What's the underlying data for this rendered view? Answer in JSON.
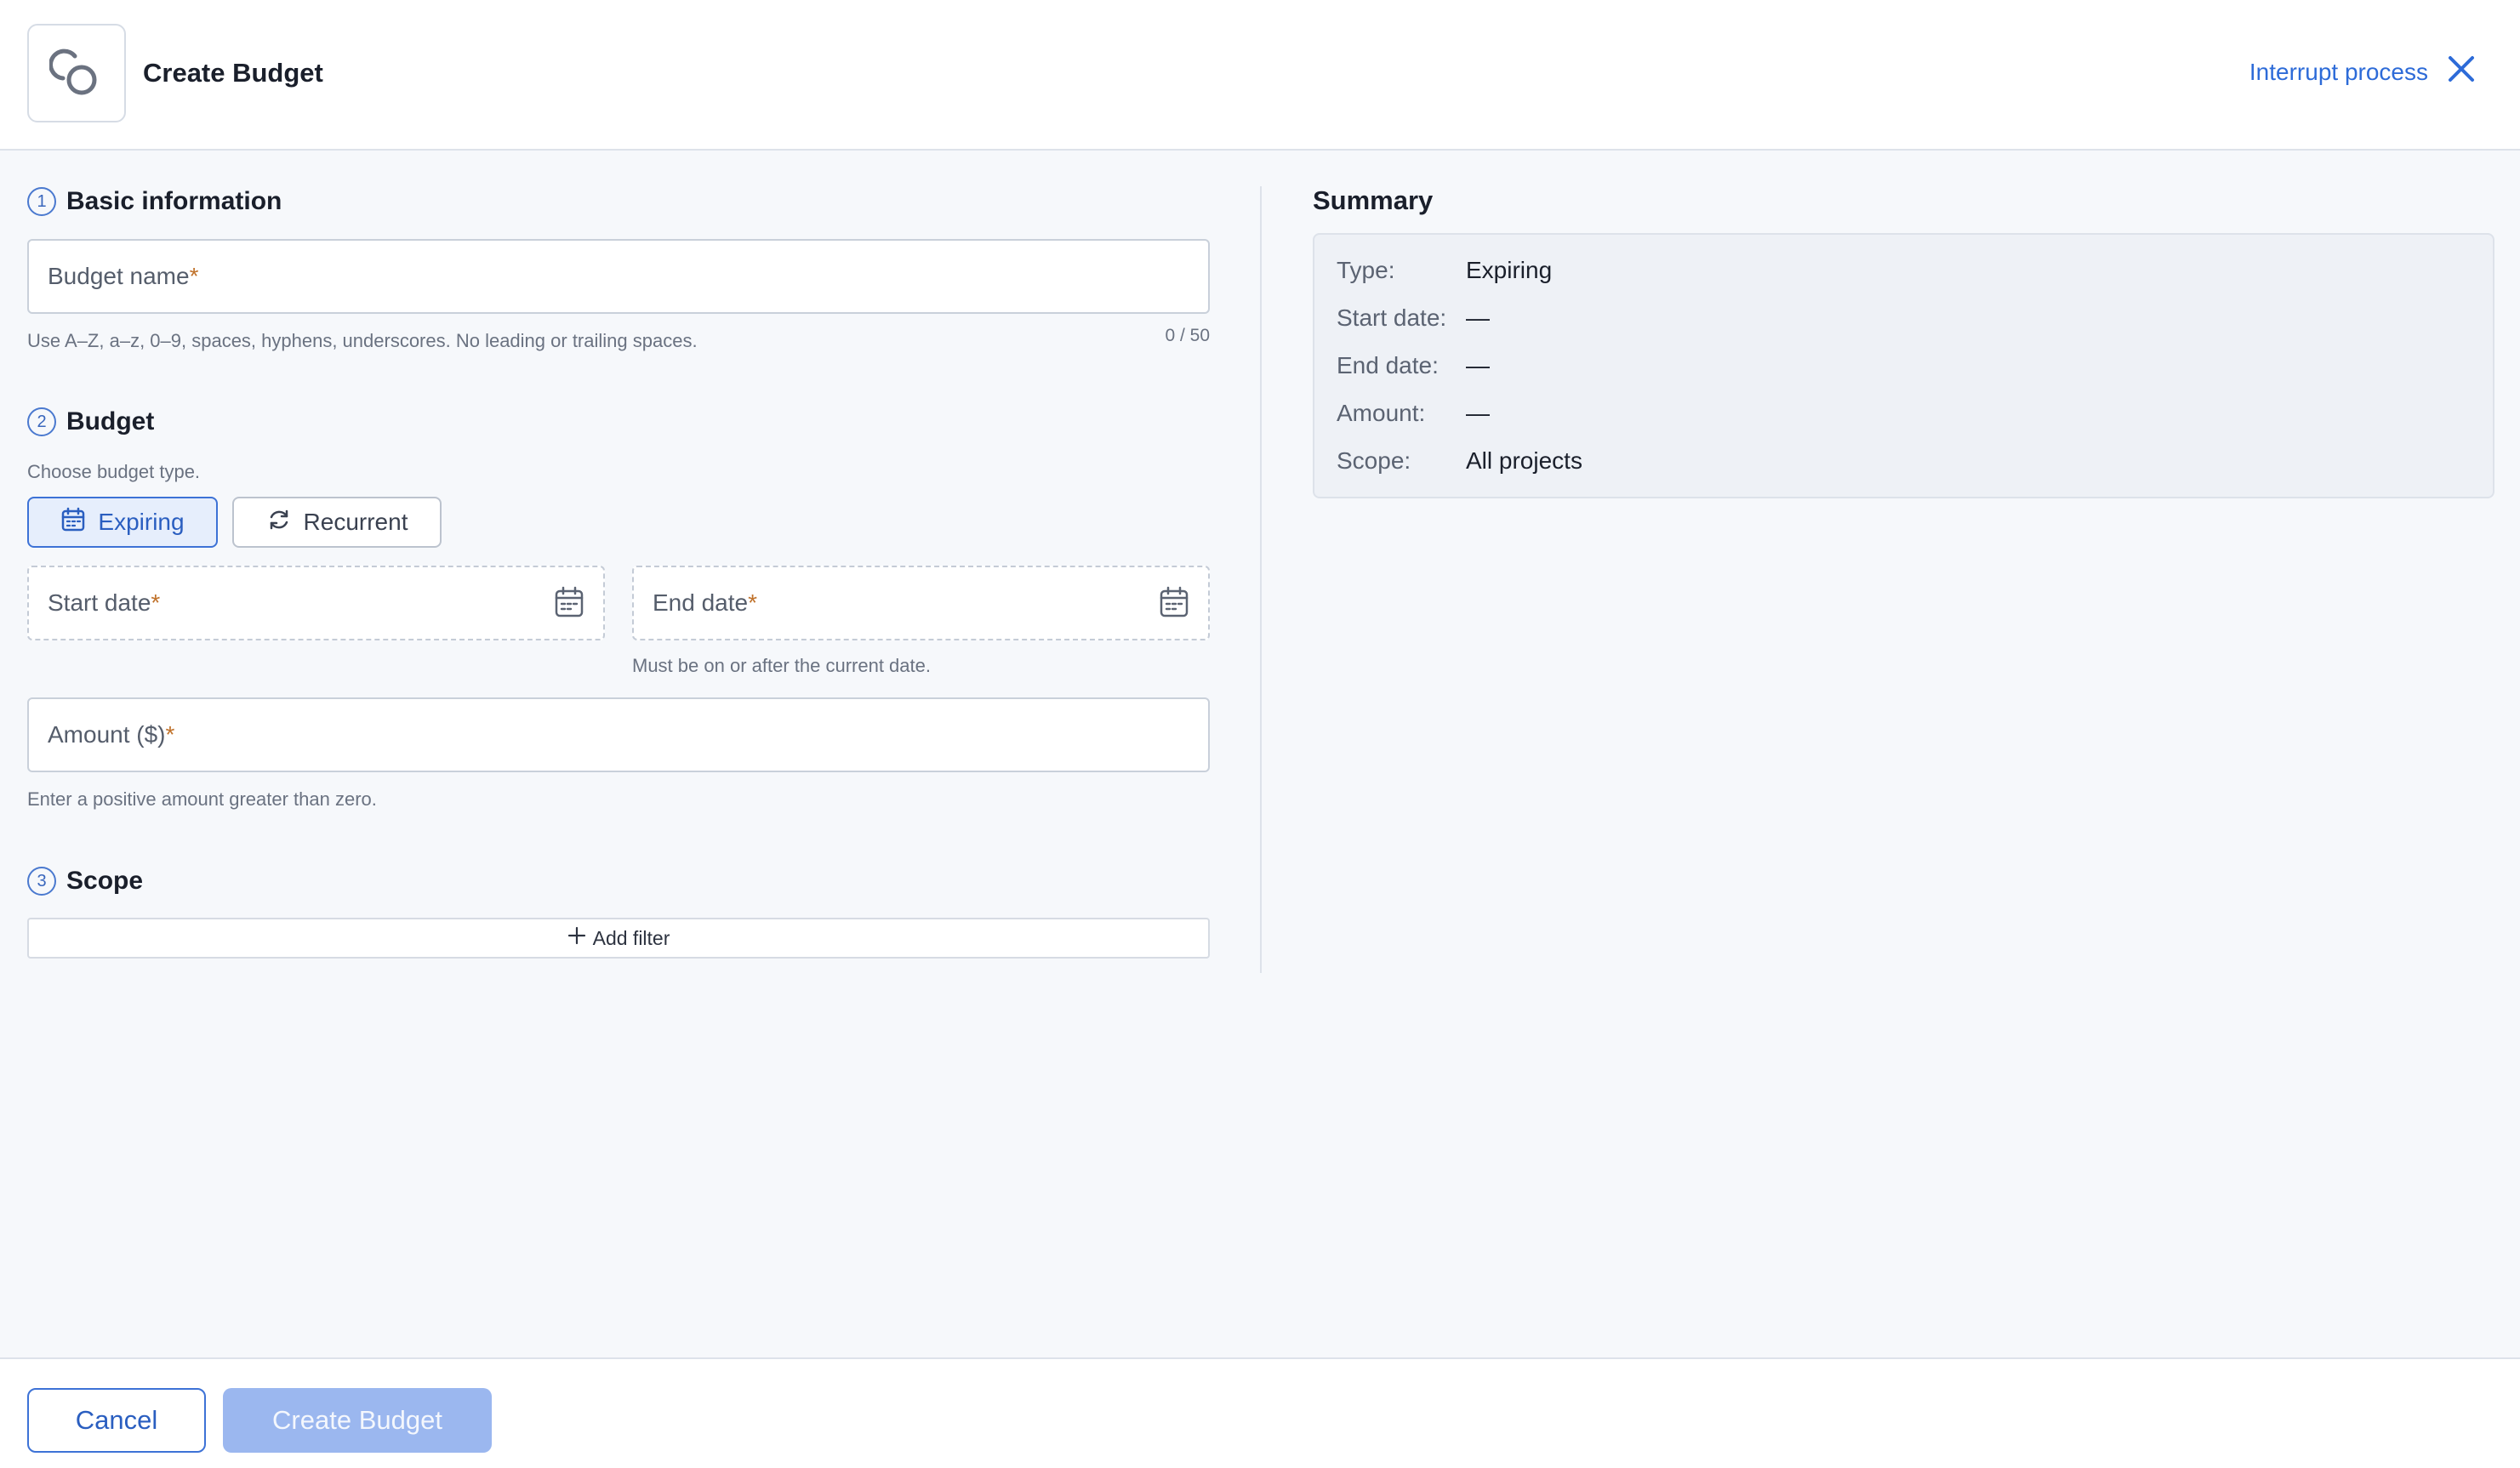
{
  "header": {
    "title": "Create Budget",
    "interrupt_label": "Interrupt process"
  },
  "basic": {
    "step": "1",
    "title": "Basic information",
    "name_label": "Budget name",
    "name_hint": "Use A–Z, a–z, 0–9, spaces, hyphens, underscores. No leading or trailing spaces.",
    "name_counter": "0 / 50"
  },
  "budget": {
    "step": "2",
    "title": "Budget",
    "type_prompt": "Choose budget type.",
    "type_options": [
      {
        "label": "Expiring",
        "icon": "calendar-icon",
        "selected": true
      },
      {
        "label": "Recurrent",
        "icon": "refresh-icon",
        "selected": false
      }
    ],
    "start_label": "Start date",
    "end_label": "End date",
    "end_hint": "Must be on or after the current date.",
    "amount_label": "Amount ($)",
    "amount_hint": "Enter a positive amount greater than zero."
  },
  "scope": {
    "step": "3",
    "title": "Scope",
    "add_filter_label": "Add filter"
  },
  "summary": {
    "title": "Summary",
    "rows": [
      {
        "label": "Type:",
        "value": "Expiring"
      },
      {
        "label": "Start date:",
        "value": "—"
      },
      {
        "label": "End date:",
        "value": "—"
      },
      {
        "label": "Amount:",
        "value": "—"
      },
      {
        "label": "Scope:",
        "value": "All projects"
      }
    ]
  },
  "footer": {
    "cancel_label": "Cancel",
    "create_label": "Create Budget"
  },
  "colors": {
    "accent": "#2d6bd8",
    "required": "#c0722b",
    "disabled_button": "#9bb7ef"
  }
}
